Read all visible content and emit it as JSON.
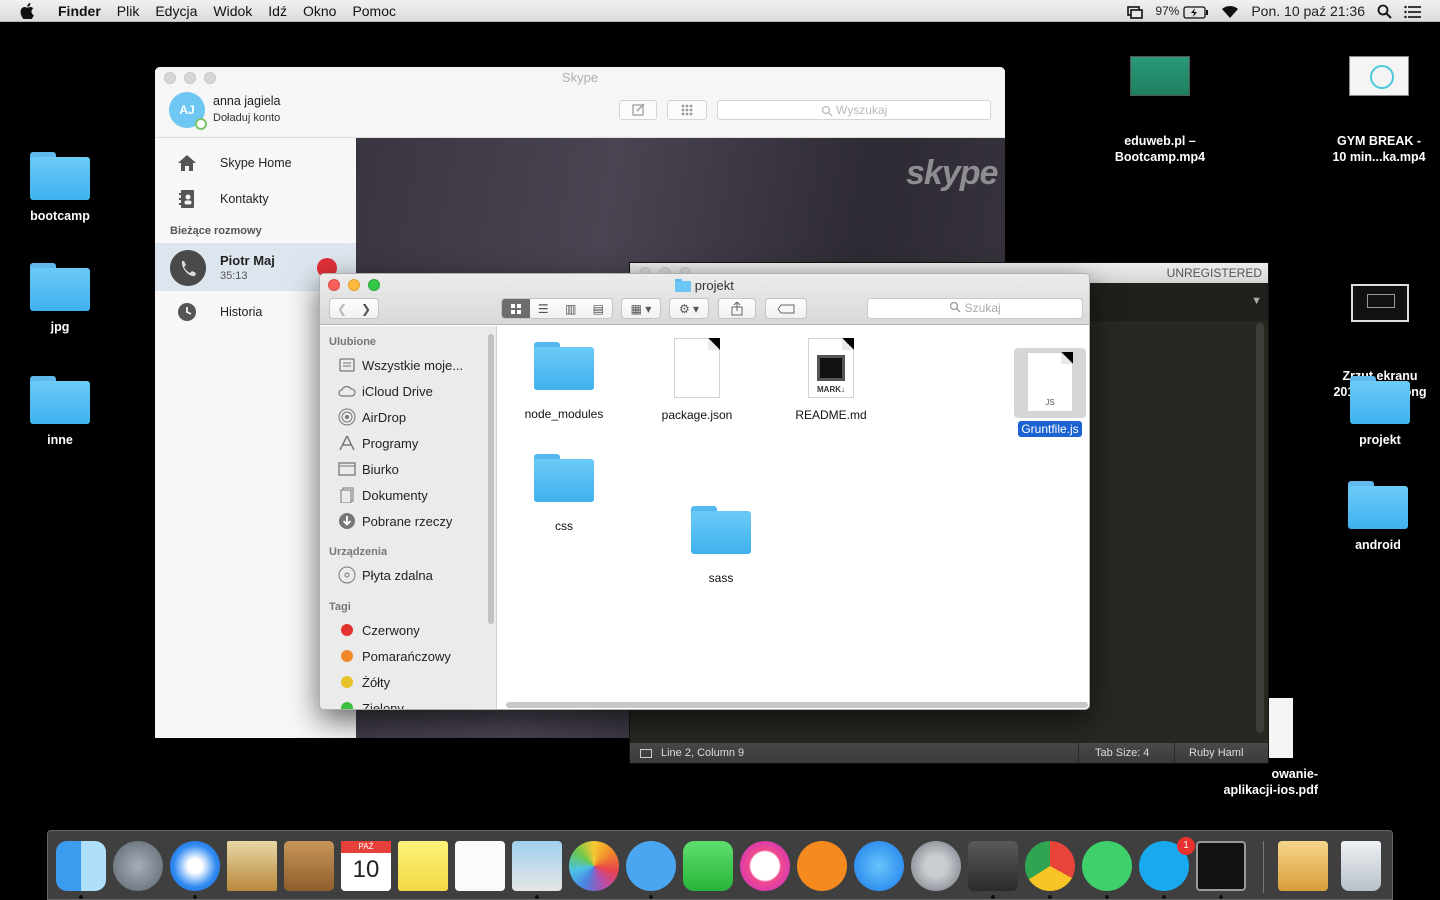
{
  "menubar": {
    "app": "Finder",
    "items": [
      "Plik",
      "Edycja",
      "Widok",
      "Idź",
      "Okno",
      "Pomoc"
    ],
    "battery": "97%",
    "clock": "Pon. 10 paź  21:36"
  },
  "desktop": {
    "left_icons": [
      {
        "label": "bootcamp"
      },
      {
        "label": "jpg"
      },
      {
        "label": "inne"
      }
    ],
    "right_icons": [
      {
        "label": "eduweb.pl –\nBootcamp.mp4"
      },
      {
        "label": "GYM BREAK -\n10 min...ka.mp4"
      },
      {
        "label": "Zrzut ekranu\n2016-1....51.png"
      },
      {
        "label": "projekt"
      },
      {
        "label": "android"
      },
      {
        "label": "owanie-\naplikacji-ios.pdf"
      }
    ]
  },
  "skype": {
    "title": "Skype",
    "avatar_initials": "AJ",
    "user_name": "anna jagiela",
    "credit": "Doładuj konto",
    "search_placeholder": "Wyszukaj",
    "nav": [
      {
        "label": "Skype Home"
      },
      {
        "label": "Kontakty"
      }
    ],
    "recent_header": "Bieżące rozmowy",
    "call": {
      "name": "Piotr Maj",
      "time": "35:13"
    },
    "history": "Historia",
    "logo": "skype"
  },
  "sublime": {
    "unregistered": "UNREGISTERED",
    "status_position": "Line 2, Column 9",
    "tab_size": "Tab Size: 4",
    "syntax": "Ruby Haml"
  },
  "finder": {
    "title": "projekt",
    "search_placeholder": "Szukaj",
    "favorites_header": "Ulubione",
    "favorites": [
      "Wszystkie moje...",
      "iCloud Drive",
      "AirDrop",
      "Programy",
      "Biurko",
      "Dokumenty",
      "Pobrane rzeczy"
    ],
    "devices_header": "Urządzenia",
    "devices": [
      "Płyta zdalna"
    ],
    "tags_header": "Tagi",
    "tags": [
      {
        "label": "Czerwony",
        "color": "#e0332d"
      },
      {
        "label": "Pomarańczowy",
        "color": "#f0892a"
      },
      {
        "label": "Żółty",
        "color": "#e7c22b"
      },
      {
        "label": "Zielony",
        "color": "#3bbf3f"
      }
    ],
    "files": [
      {
        "label": "node_modules",
        "kind": "folder"
      },
      {
        "label": "package.json",
        "kind": "file"
      },
      {
        "label": "README.md",
        "kind": "markdown",
        "badge": "MARK↓"
      },
      {
        "label": "Gruntfile.js",
        "kind": "js",
        "badge": "JS",
        "selected": true
      },
      {
        "label": "css",
        "kind": "folder"
      },
      {
        "label": "sass",
        "kind": "folder"
      }
    ]
  },
  "dock": {
    "calendar_month": "PAŹ",
    "calendar_day": "10",
    "skype_badge": "1",
    "apps": [
      "finder",
      "launchpad",
      "safari",
      "mail",
      "contacts",
      "calendar",
      "notes",
      "reminders",
      "preview",
      "photos",
      "messages",
      "facetime",
      "itunes",
      "ibooks",
      "app-store",
      "system-preferences",
      "sublime-text",
      "chrome",
      "whatsapp",
      "skype",
      "terminal",
      "installer",
      "trash"
    ]
  }
}
